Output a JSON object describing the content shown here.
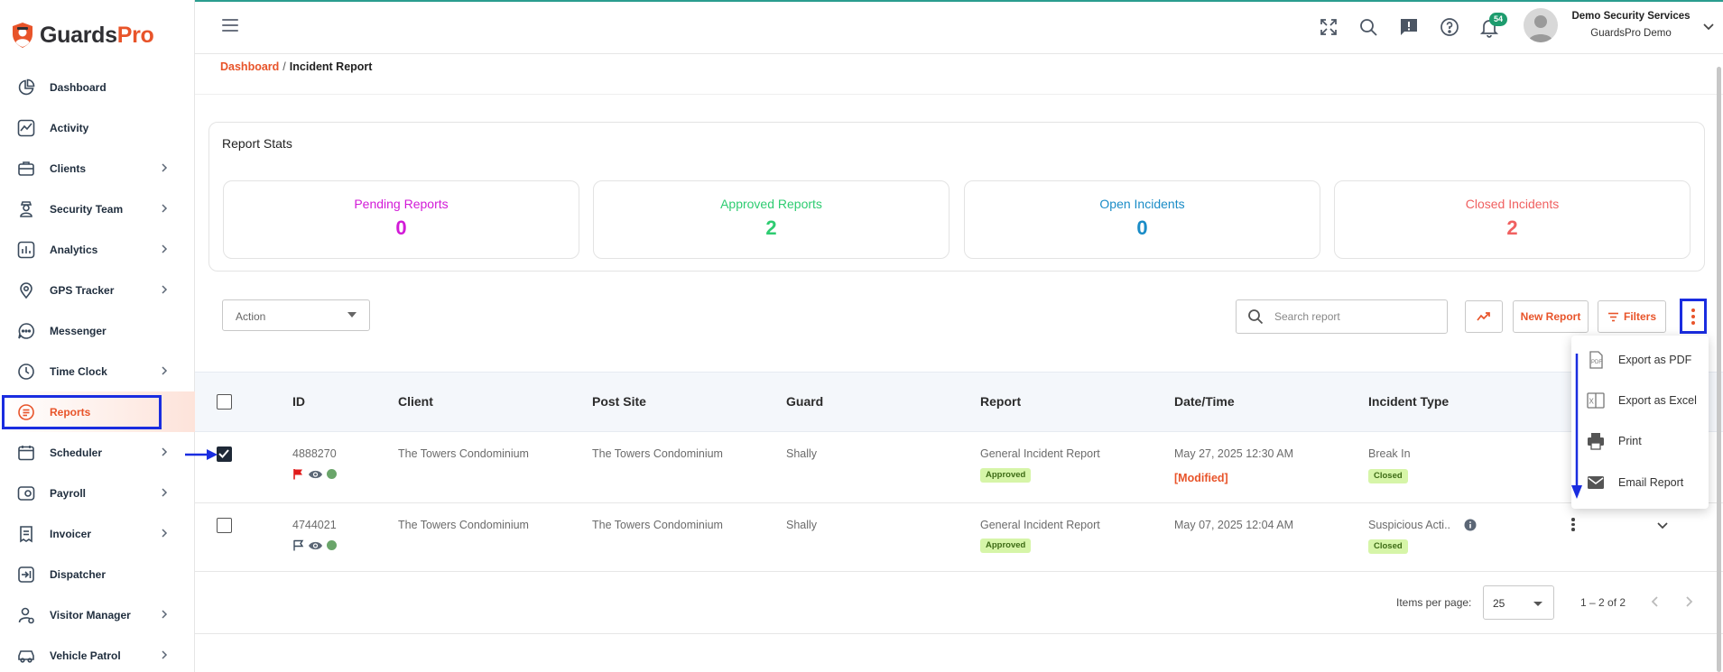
{
  "app": {
    "brand_part1": "Guards",
    "brand_part2": "Pro",
    "accent": "#e8542a"
  },
  "sidebar": {
    "items": [
      {
        "label": "Dashboard",
        "icon": "dashboard-icon",
        "has_submenu": false,
        "active": false
      },
      {
        "label": "Activity",
        "icon": "activity-icon",
        "has_submenu": false,
        "active": false
      },
      {
        "label": "Clients",
        "icon": "clients-icon",
        "has_submenu": true,
        "active": false
      },
      {
        "label": "Security Team",
        "icon": "security-team-icon",
        "has_submenu": true,
        "active": false
      },
      {
        "label": "Analytics",
        "icon": "analytics-icon",
        "has_submenu": true,
        "active": false
      },
      {
        "label": "GPS Tracker",
        "icon": "gps-icon",
        "has_submenu": true,
        "active": false
      },
      {
        "label": "Messenger",
        "icon": "messenger-icon",
        "has_submenu": false,
        "active": false
      },
      {
        "label": "Time Clock",
        "icon": "clock-icon",
        "has_submenu": true,
        "active": false
      },
      {
        "label": "Reports",
        "icon": "reports-icon",
        "has_submenu": false,
        "active": true
      },
      {
        "label": "Scheduler",
        "icon": "scheduler-icon",
        "has_submenu": true,
        "active": false
      },
      {
        "label": "Payroll",
        "icon": "payroll-icon",
        "has_submenu": true,
        "active": false
      },
      {
        "label": "Invoicer",
        "icon": "invoicer-icon",
        "has_submenu": true,
        "active": false
      },
      {
        "label": "Dispatcher",
        "icon": "dispatcher-icon",
        "has_submenu": false,
        "active": false
      },
      {
        "label": "Visitor Manager",
        "icon": "visitor-icon",
        "has_submenu": true,
        "active": false
      },
      {
        "label": "Vehicle Patrol",
        "icon": "vehicle-icon",
        "has_submenu": true,
        "active": false
      }
    ]
  },
  "header": {
    "notification_count": "54",
    "user_name": "Demo Security Services",
    "user_org": "GuardsPro Demo"
  },
  "breadcrumb": {
    "root": "Dashboard",
    "separator": "/",
    "current": "Incident Report"
  },
  "stats": {
    "title": "Report Stats",
    "cards": [
      {
        "label": "Pending Reports",
        "value": "0",
        "color": "#d21ad7"
      },
      {
        "label": "Approved Reports",
        "value": "2",
        "color": "#2ecc71"
      },
      {
        "label": "Open Incidents",
        "value": "0",
        "color": "#1a8cc7"
      },
      {
        "label": "Closed Incidents",
        "value": "2",
        "color": "#f06060"
      }
    ]
  },
  "toolbar": {
    "action_label": "Action",
    "search_placeholder": "Search report",
    "new_report_label": "New Report",
    "filters_label": "Filters"
  },
  "table": {
    "columns": [
      "ID",
      "Client",
      "Post Site",
      "Guard",
      "Report",
      "Date/Time",
      "Incident Type"
    ],
    "rows": [
      {
        "checked": true,
        "id": "4888270",
        "client": "The Towers Condominium",
        "post_site": "The Towers Condominium",
        "guard": "Shally",
        "report": "General Incident Report",
        "report_status": "Approved",
        "datetime": "May 27, 2025 12:30 AM",
        "modified": "[Modified]",
        "incident_type": "Break In",
        "incident_status": "Closed",
        "flag_color": "#e01b1b"
      },
      {
        "checked": false,
        "id": "4744021",
        "client": "The Towers Condominium",
        "post_site": "The Towers Condominium",
        "guard": "Shally",
        "report": "General Incident Report",
        "report_status": "Approved",
        "datetime": "May 07, 2025 12:04 AM",
        "modified": "",
        "incident_type": "Suspicious Acti..",
        "incident_status": "Closed",
        "flag_color": "outline"
      }
    ]
  },
  "pagination": {
    "items_per_page_label": "Items per page:",
    "items_per_page": "25",
    "range": "1 – 2 of 2"
  },
  "export_menu": {
    "items": [
      {
        "label": "Export as PDF",
        "icon": "pdf-icon"
      },
      {
        "label": "Export as Excel",
        "icon": "excel-icon"
      },
      {
        "label": "Print",
        "icon": "print-icon"
      },
      {
        "label": "Email Report",
        "icon": "email-icon"
      }
    ]
  }
}
